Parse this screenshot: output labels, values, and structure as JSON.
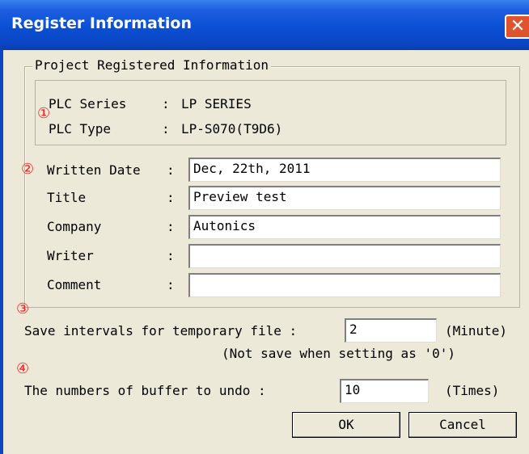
{
  "window": {
    "title": "Register Information",
    "close_glyph": "✕"
  },
  "group": {
    "label": "Project Registered Information"
  },
  "plc": {
    "series_label": "PLC Series",
    "series_sep": ":",
    "series_value": "LP SERIES",
    "type_label": "PLC Type",
    "type_sep": ":",
    "type_value": "LP-S070(T9D6)"
  },
  "markers": {
    "m1": "①",
    "m2": "②",
    "m3": "③",
    "m4": "④"
  },
  "fields": {
    "written_date": {
      "label": "Written Date",
      "sep": ":",
      "value": "Dec, 22th, 2011"
    },
    "title": {
      "label": "Title",
      "sep": ":",
      "value": "Preview test"
    },
    "company": {
      "label": "Company",
      "sep": ":",
      "value": "Autonics"
    },
    "writer": {
      "label": "Writer",
      "sep": ":",
      "value": ""
    },
    "comment": {
      "label": "Comment",
      "sep": ":",
      "value": ""
    }
  },
  "save_interval": {
    "label": "Save intervals for temporary file :",
    "value": "2",
    "unit": "(Minute)",
    "note": "(Not save when setting as '0')"
  },
  "undo": {
    "label": "The numbers of buffer to undo :",
    "value": "10",
    "unit": "(Times)"
  },
  "buttons": {
    "ok": "OK",
    "cancel": "Cancel"
  }
}
